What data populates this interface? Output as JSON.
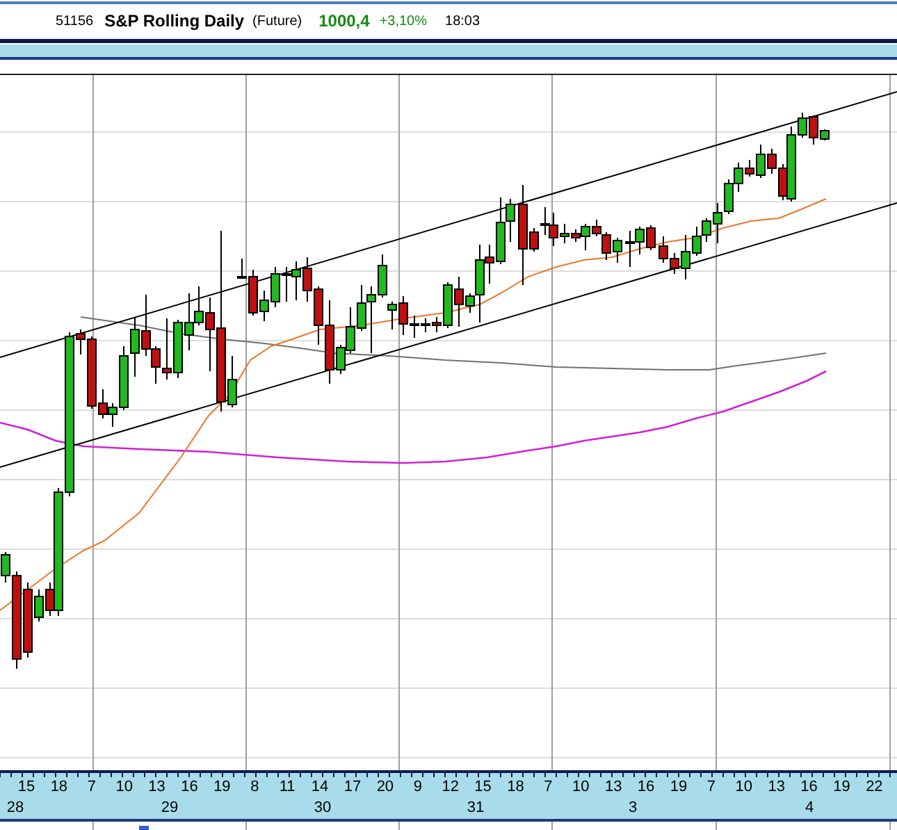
{
  "header": {
    "code": "51156",
    "title": "S&P Rolling Daily",
    "type": "(Future)",
    "price": "1000,4",
    "change": "+3,10%",
    "time": "18:03"
  },
  "x_axis": {
    "ticks": [
      "15",
      "18",
      "7",
      "10",
      "13",
      "16",
      "19",
      "8",
      "11",
      "14",
      "17",
      "20",
      "9",
      "12",
      "15",
      "18",
      "7",
      "10",
      "13",
      "16",
      "19",
      "7",
      "10",
      "13",
      "16",
      "19",
      "22"
    ],
    "dates": [
      "28",
      "29",
      "30",
      "31",
      "3",
      "4"
    ]
  }
}
